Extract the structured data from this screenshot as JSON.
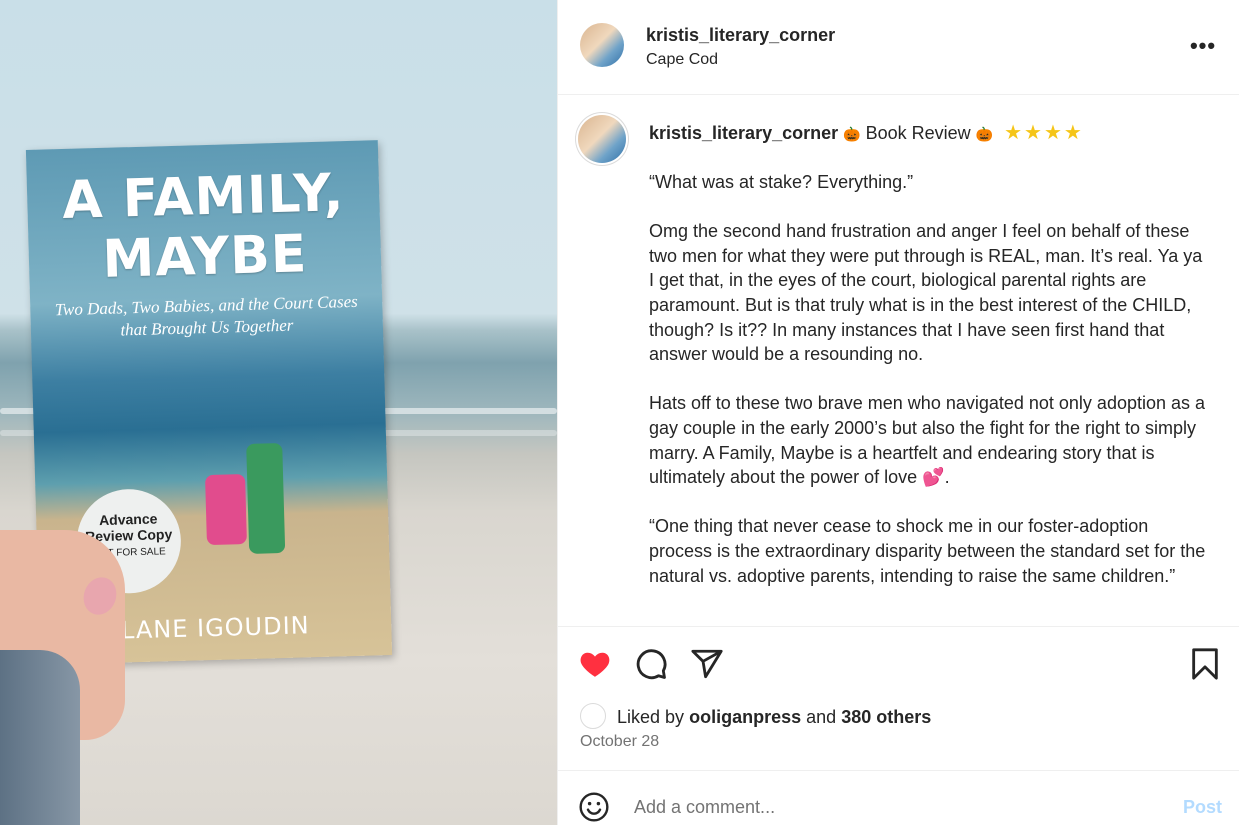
{
  "photo": {
    "book_title_line1": "A FAMILY,",
    "book_title_line2": "MAYBE",
    "book_subtitle": "Two Dads, Two Babies, and the Court Cases that Brought Us Together",
    "badge_line1": "Advance Review Copy",
    "badge_line2": "NOT FOR SALE",
    "author": "LANE IGOUDIN"
  },
  "header": {
    "username": "kristis_literary_corner",
    "location": "Cape Cod",
    "more_label": "•••"
  },
  "caption": {
    "username": "kristis_literary_corner",
    "tag": "Book Review",
    "pumpkin": "🎃",
    "stars": "★★★★",
    "paragraphs": [
      "“What was at stake? Everything.”",
      "Omg the second hand frustration and anger I feel on behalf of these two men for what they were put through is REAL, man. It’s real. Ya ya I get that, in the eyes of the court, biological parental rights are paramount. But is that truly what is in the best interest of the CHILD, though? Is it?? In many instances that I have seen first hand that answer would be a resounding no.",
      "Hats off to these two brave men who navigated not only adoption as a gay couple in the early 2000’s but also the fight for the right to simply marry. A Family, Maybe is a heartfelt and endearing story that is ultimately about the power of love",
      "“One thing that never cease to shock me in our foster-adoption process is the extraordinary disparity between the standard set for the natural vs. adoptive parents, intending to raise the same children.”"
    ],
    "love_emoji": "💕",
    "period": "."
  },
  "likes": {
    "prefix": "Liked by",
    "user": "ooliganpress",
    "and": "and",
    "others": "380 others"
  },
  "date": "October 28",
  "comment": {
    "placeholder": "Add a comment...",
    "post_label": "Post"
  },
  "colors": {
    "like_red": "#ff3040",
    "post_blue": "#b3dbff",
    "star_yellow": "#f5c518"
  }
}
